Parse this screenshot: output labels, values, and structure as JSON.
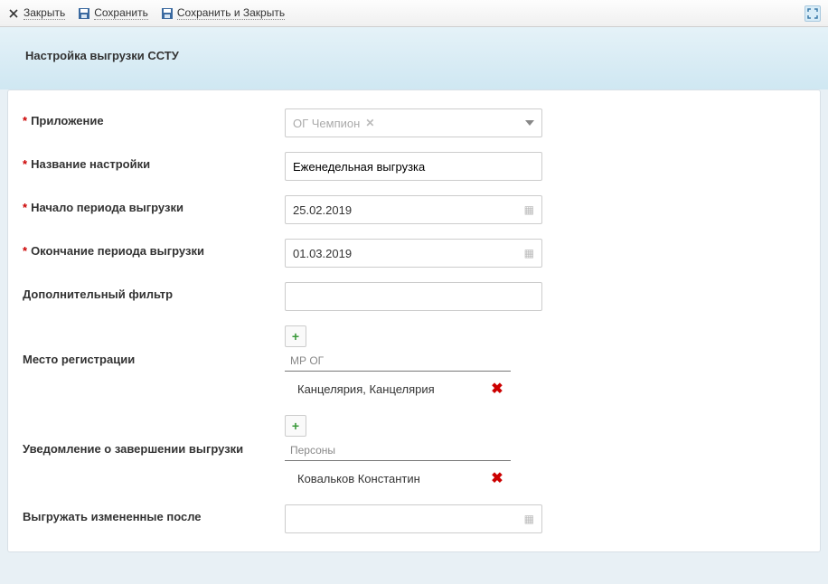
{
  "toolbar": {
    "close": "Закрыть",
    "save": "Сохранить",
    "save_close": "Сохранить и Закрыть"
  },
  "header": {
    "title": "Настройка выгрузки ССТУ"
  },
  "form": {
    "app": {
      "label": "Приложение",
      "value": "ОГ Чемпион"
    },
    "name": {
      "label": "Название настройки",
      "value": "Еженедельная выгрузка"
    },
    "period_start": {
      "label": "Начало периода выгрузки",
      "value": "25.02.2019"
    },
    "period_end": {
      "label": "Окончание периода выгрузки",
      "value": "01.03.2019"
    },
    "extra_filter": {
      "label": "Дополнительный фильтр",
      "value": ""
    },
    "reg_place": {
      "label": "Место регистрации",
      "col_header": "МР ОГ",
      "items": [
        "Канцелярия, Канцелярия"
      ]
    },
    "notify": {
      "label": "Уведомление о завершении выгрузки",
      "col_header": "Персоны",
      "items": [
        "Ковальков Константин"
      ]
    },
    "changed_after": {
      "label": "Выгружать измененные после",
      "value": ""
    }
  }
}
